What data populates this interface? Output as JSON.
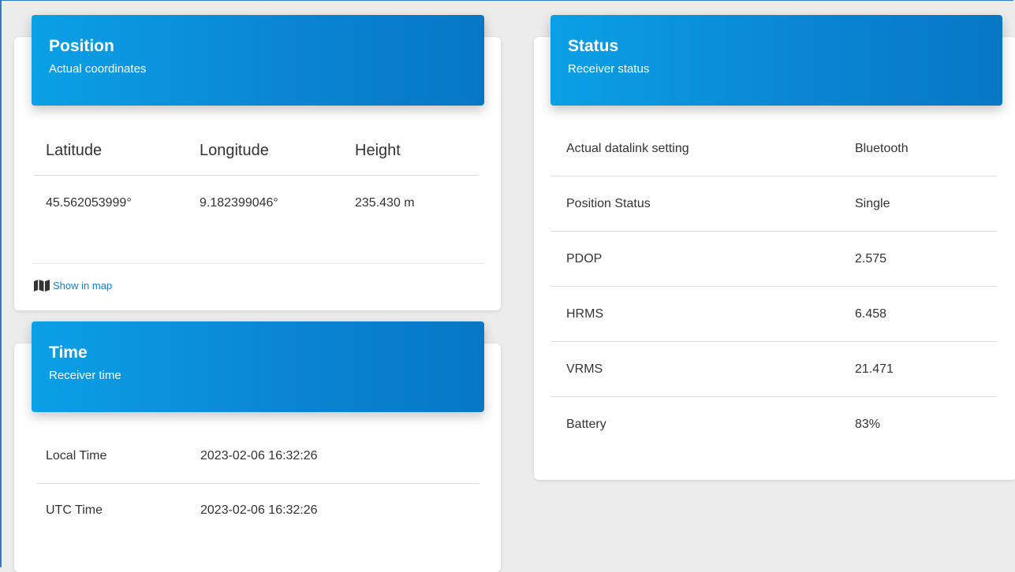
{
  "position": {
    "title": "Position",
    "subtitle": "Actual coordinates",
    "columns": [
      "Latitude",
      "Longitude",
      "Height"
    ],
    "values": [
      "45.562053999°",
      "9.182399046°",
      "235.430 m"
    ],
    "map_link": "Show in map",
    "map_icon": "map-icon"
  },
  "time": {
    "title": "Time",
    "subtitle": "Receiver time",
    "rows": [
      {
        "label": "Local Time",
        "value": "2023-02-06 16:32:26"
      },
      {
        "label": "UTC Time",
        "value": "2023-02-06 16:32:26"
      }
    ]
  },
  "status": {
    "title": "Status",
    "subtitle": "Receiver status",
    "rows": [
      {
        "label": "Actual datalink setting",
        "value": "Bluetooth"
      },
      {
        "label": "Position Status",
        "value": "Single"
      },
      {
        "label": "PDOP",
        "value": "2.575"
      },
      {
        "label": "HRMS",
        "value": "6.458"
      },
      {
        "label": "VRMS",
        "value": "21.471"
      },
      {
        "label": "Battery",
        "value": "83%"
      }
    ]
  },
  "colors": {
    "header_start": "#0aa0e6",
    "header_end": "#0677c5",
    "link": "#1a79c8",
    "background": "#ececec"
  }
}
